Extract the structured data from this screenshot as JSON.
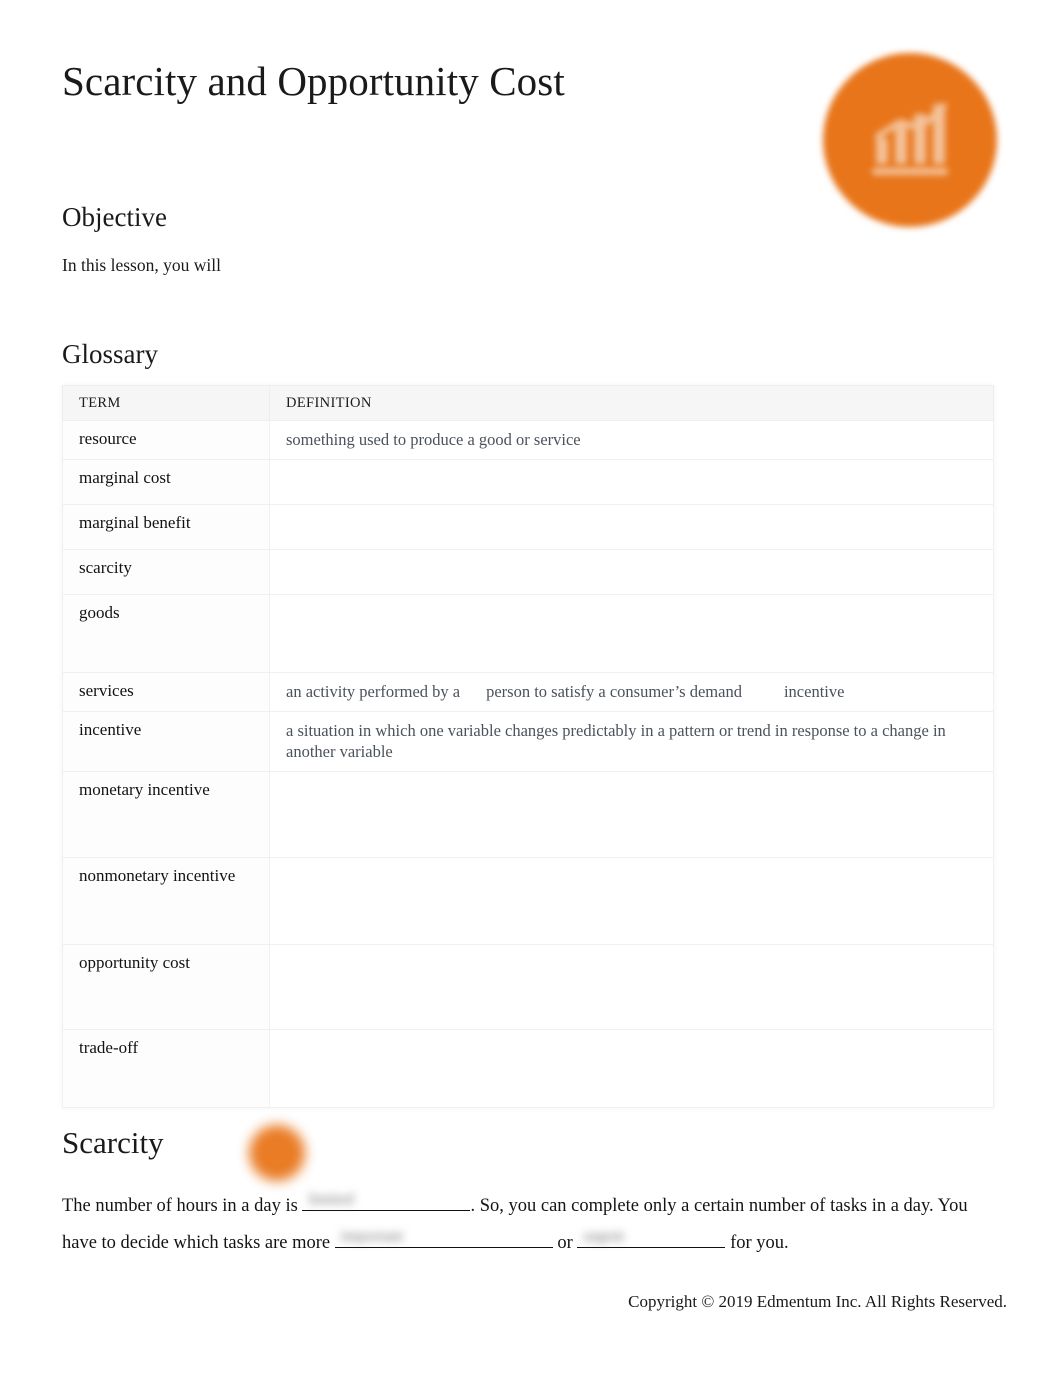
{
  "document": {
    "title": "Scarcity and Opportunity Cost",
    "logo_icon": "bar-chart-logo-icon",
    "brand_color": "#e8751a"
  },
  "objective": {
    "heading": "Objective",
    "text": "In this lesson, you will"
  },
  "glossary": {
    "heading": "Glossary",
    "columns": {
      "term": "TERM",
      "definition": "DEFINITION"
    },
    "rows": [
      {
        "term": "resource",
        "definition": "something used to produce a good or service"
      },
      {
        "term": "marginal cost",
        "definition": ""
      },
      {
        "term": "marginal benefit",
        "definition": ""
      },
      {
        "term": "scarcity",
        "definition": ""
      },
      {
        "term": "goods",
        "definition": ""
      },
      {
        "term": "services",
        "definition_part1": "an activity performed by a",
        "definition_part2": "person to satisfy a consumer’s demand",
        "definition_part3": "incentive"
      },
      {
        "term": "incentive",
        "definition": "a situation in which one variable changes predictably in a pattern or trend in response to a change in another variable"
      },
      {
        "term": "monetary incentive",
        "definition": ""
      },
      {
        "term": "nonmonetary incentive",
        "definition": ""
      },
      {
        "term": "opportunity cost",
        "definition": ""
      },
      {
        "term": "trade-off",
        "definition": ""
      }
    ]
  },
  "scarcity": {
    "heading": "Scarcity",
    "badge_icon": "orange-step-badge-icon",
    "paragraph": {
      "segment_1": "The number of hours in a day is ",
      "blank_1_answer": "limited",
      "segment_2": ". So, you can complete only a certain number of tasks in a day. You have to decide which tasks are more ",
      "blank_2_answer": "important",
      "segment_3": " or ",
      "blank_3_answer": "urgent",
      "segment_4": " for you."
    }
  },
  "footer": {
    "copyright": "Copyright © 2019 Edmentum Inc. All Rights Reserved."
  }
}
